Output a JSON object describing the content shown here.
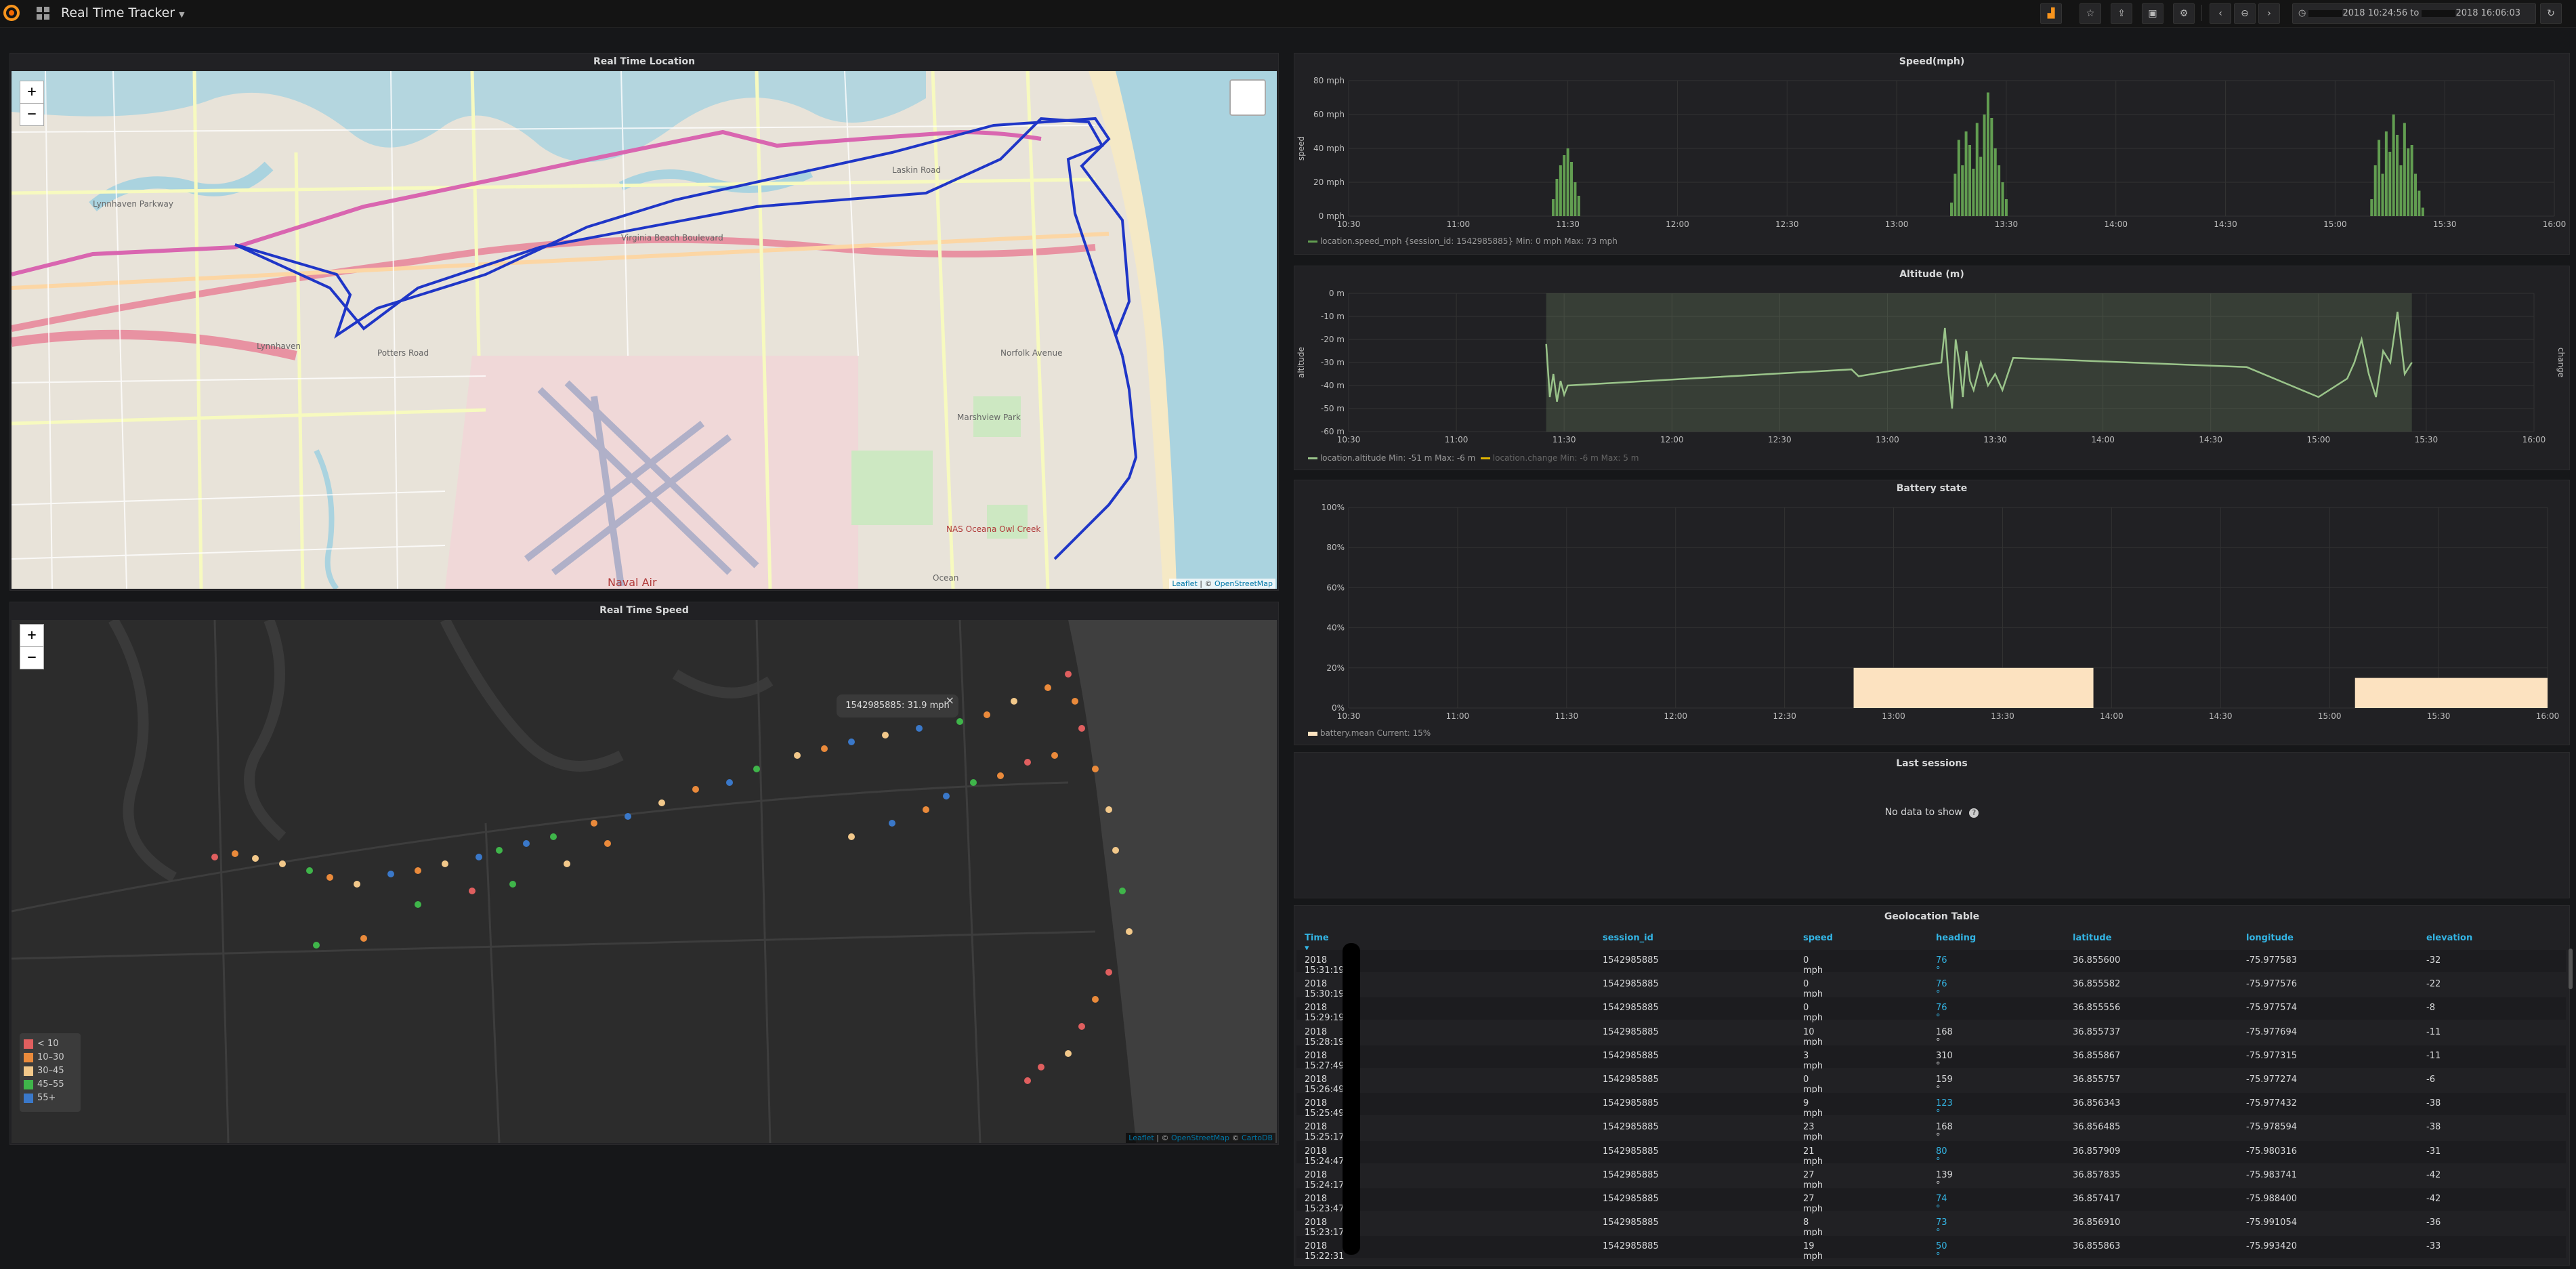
{
  "navbar": {
    "title": "Real Time Tracker",
    "time_range_from": "2018 10:24:56",
    "time_range_to_word": "to",
    "time_range_to": "2018 16:06:03",
    "icons": [
      "add-panel-icon",
      "star-icon",
      "share-icon",
      "save-icon",
      "gear-icon",
      "chevron-left-icon",
      "zoom-out-icon",
      "chevron-right-icon",
      "clock-icon",
      "refresh-icon"
    ]
  },
  "map1": {
    "title": "Real Time Location",
    "zoom_in": "+",
    "zoom_out": "−",
    "attrib_leaflet": "Leaflet",
    "attrib_osm": "OpenStreetMap",
    "place_labels": [
      "Lynnhaven",
      "Marshview Park",
      "NAS Oceana Owl Creek",
      "Naval Air",
      "Virginia Beach Boulevard",
      "Norfolk Avenue",
      "Potters Road",
      "Lynnhaven Parkway",
      "Laskin Road",
      "Ocean"
    ]
  },
  "map2": {
    "title": "Real Time Speed",
    "zoom_in": "+",
    "zoom_out": "−",
    "popup": "1542985885: 31.9 mph",
    "popup_close": "×",
    "attrib_leaflet": "Leaflet",
    "attrib_osm": "OpenStreetMap",
    "attrib_carto": "CartoDB",
    "legend": [
      {
        "label": "< 10",
        "color": "#e05f5f"
      },
      {
        "label": "10–30",
        "color": "#ea8a3b"
      },
      {
        "label": "30–45",
        "color": "#f2c88a"
      },
      {
        "label": "45–55",
        "color": "#3fb54a"
      },
      {
        "label": "55+",
        "color": "#3a78c9"
      }
    ]
  },
  "speed_panel": {
    "title": "Speed(mph)",
    "ylabel": "speed",
    "legend": "location.speed_mph {session_id: 1542985885}  Min: 0 mph  Max: 73 mph"
  },
  "altitude_panel": {
    "title": "Altitude (m)",
    "ylabel": "altitude",
    "ylabel_right": "change",
    "legend_1": "location.altitude  Min: -51 m  Max: -6 m",
    "legend_2": "location.change  Min: -6 m  Max: 5 m"
  },
  "battery_panel": {
    "title": "Battery state",
    "legend": "battery.mean  Current: 15%"
  },
  "sessions_panel": {
    "title": "Last sessions",
    "empty_text": "No data to show",
    "help_icon": "question-icon"
  },
  "table_panel": {
    "title": "Geolocation Table",
    "columns": [
      "Time",
      "session_id",
      "speed",
      "heading",
      "latitude",
      "longitude",
      "elevation"
    ],
    "rows": [
      [
        "2018 15:31:19",
        "1542985885",
        "0 mph",
        "76 °",
        "36.855600",
        "-75.977583",
        "-32"
      ],
      [
        "2018 15:30:19",
        "1542985885",
        "0 mph",
        "76 °",
        "36.855582",
        "-75.977576",
        "-22"
      ],
      [
        "2018 15:29:19",
        "1542985885",
        "0 mph",
        "76 °",
        "36.855556",
        "-75.977574",
        "-8"
      ],
      [
        "2018 15:28:19",
        "1542985885",
        "10 mph",
        "168 °",
        "36.855737",
        "-75.977694",
        "-11"
      ],
      [
        "2018 15:27:49",
        "1542985885",
        "3 mph",
        "310 °",
        "36.855867",
        "-75.977315",
        "-11"
      ],
      [
        "2018 15:26:49",
        "1542985885",
        "0 mph",
        "159 °",
        "36.855757",
        "-75.977274",
        "-6"
      ],
      [
        "2018 15:25:49",
        "1542985885",
        "9 mph",
        "123 °",
        "36.856343",
        "-75.977432",
        "-38"
      ],
      [
        "2018 15:25:17",
        "1542985885",
        "23 mph",
        "168 °",
        "36.856485",
        "-75.978594",
        "-38"
      ],
      [
        "2018 15:24:47",
        "1542985885",
        "21 mph",
        "80 °",
        "36.857909",
        "-75.980316",
        "-31"
      ],
      [
        "2018 15:24:17",
        "1542985885",
        "27 mph",
        "139 °",
        "36.857835",
        "-75.983741",
        "-42"
      ],
      [
        "2018 15:23:47",
        "1542985885",
        "27 mph",
        "74 °",
        "36.857417",
        "-75.988400",
        "-42"
      ],
      [
        "2018 15:23:17",
        "1542985885",
        "8 mph",
        "73 °",
        "36.856910",
        "-75.991054",
        "-36"
      ],
      [
        "2018 15:22:31",
        "1542985885",
        "19 mph",
        "50 °",
        "36.855863",
        "-75.993420",
        "-33"
      ]
    ],
    "blue_heading": [
      true,
      true,
      true,
      false,
      false,
      false,
      true,
      false,
      true,
      false,
      true,
      true,
      true
    ]
  },
  "chart_data": [
    {
      "type": "bar",
      "title": "Speed(mph)",
      "ylabel": "speed",
      "x_ticks": [
        "10:30",
        "11:00",
        "11:30",
        "12:00",
        "12:30",
        "13:00",
        "13:30",
        "14:00",
        "14:30",
        "15:00",
        "15:30",
        "16:00"
      ],
      "y_ticks": [
        "0 mph",
        "20 mph",
        "40 mph",
        "60 mph",
        "80 mph"
      ],
      "ylim": [
        0,
        80
      ],
      "series": [
        {
          "name": "location.speed_mph {session_id: 1542985885}",
          "color": "#629e51",
          "points": [
            [
              "11:26",
              10
            ],
            [
              "11:27",
              22
            ],
            [
              "11:28",
              30
            ],
            [
              "11:29",
              36
            ],
            [
              "11:30",
              40
            ],
            [
              "11:31",
              32
            ],
            [
              "11:32",
              20
            ],
            [
              "11:33",
              12
            ],
            [
              "13:15",
              8
            ],
            [
              "13:16",
              25
            ],
            [
              "13:17",
              45
            ],
            [
              "13:18",
              30
            ],
            [
              "13:19",
              50
            ],
            [
              "13:20",
              42
            ],
            [
              "13:21",
              28
            ],
            [
              "13:22",
              55
            ],
            [
              "13:23",
              35
            ],
            [
              "13:24",
              60
            ],
            [
              "13:25",
              73
            ],
            [
              "13:26",
              58
            ],
            [
              "13:27",
              40
            ],
            [
              "13:28",
              30
            ],
            [
              "13:29",
              20
            ],
            [
              "13:30",
              10
            ],
            [
              "15:10",
              10
            ],
            [
              "15:11",
              30
            ],
            [
              "15:12",
              45
            ],
            [
              "15:13",
              25
            ],
            [
              "15:14",
              50
            ],
            [
              "15:15",
              38
            ],
            [
              "15:16",
              60
            ],
            [
              "15:17",
              48
            ],
            [
              "15:18",
              30
            ],
            [
              "15:19",
              55
            ],
            [
              "15:20",
              40
            ],
            [
              "15:21",
              42
            ],
            [
              "15:22",
              25
            ],
            [
              "15:23",
              15
            ],
            [
              "15:24",
              5
            ]
          ]
        }
      ]
    },
    {
      "type": "line",
      "title": "Altitude (m)",
      "ylabel": "altitude",
      "x_ticks": [
        "10:30",
        "11:00",
        "11:30",
        "12:00",
        "12:30",
        "13:00",
        "13:30",
        "14:00",
        "14:30",
        "15:00",
        "15:30",
        "16:00"
      ],
      "y_ticks": [
        "0 m",
        "-10 m",
        "-20 m",
        "-30 m",
        "-40 m",
        "-50 m",
        "-60 m"
      ],
      "ylim": [
        -60,
        0
      ],
      "series": [
        {
          "name": "location.altitude",
          "color": "#9ac48a",
          "points": [
            [
              "11:25",
              -22
            ],
            [
              "11:26",
              -45
            ],
            [
              "11:27",
              -35
            ],
            [
              "11:28",
              -47
            ],
            [
              "11:29",
              -38
            ],
            [
              "11:30",
              -44
            ],
            [
              "11:31",
              -40
            ],
            [
              "12:50",
              -33
            ],
            [
              "12:52",
              -36
            ],
            [
              "13:15",
              -30
            ],
            [
              "13:16",
              -15
            ],
            [
              "13:17",
              -35
            ],
            [
              "13:18",
              -50
            ],
            [
              "13:19",
              -20
            ],
            [
              "13:20",
              -30
            ],
            [
              "13:21",
              -45
            ],
            [
              "13:22",
              -25
            ],
            [
              "13:23",
              -38
            ],
            [
              "13:24",
              -42
            ],
            [
              "13:26",
              -30
            ],
            [
              "13:28",
              -40
            ],
            [
              "13:30",
              -35
            ],
            [
              "13:32",
              -42
            ],
            [
              "13:35",
              -28
            ],
            [
              "14:40",
              -32
            ],
            [
              "15:00",
              -45
            ],
            [
              "15:08",
              -37
            ],
            [
              "15:10",
              -30
            ],
            [
              "15:12",
              -20
            ],
            [
              "15:14",
              -35
            ],
            [
              "15:16",
              -45
            ],
            [
              "15:18",
              -25
            ],
            [
              "15:20",
              -30
            ],
            [
              "15:22",
              -8
            ],
            [
              "15:24",
              -35
            ],
            [
              "15:26",
              -30
            ]
          ]
        }
      ]
    },
    {
      "type": "area",
      "title": "Battery state",
      "x_ticks": [
        "10:30",
        "11:00",
        "11:30",
        "12:00",
        "12:30",
        "13:00",
        "13:30",
        "14:00",
        "14:30",
        "15:00",
        "15:30",
        "16:00"
      ],
      "y_ticks": [
        "0%",
        "20%",
        "40%",
        "60%",
        "80%",
        "100%"
      ],
      "ylim": [
        0,
        100
      ],
      "series": [
        {
          "name": "battery.mean",
          "color": "#fce2c0",
          "points": [
            [
              "12:49",
              20
            ],
            [
              "13:55",
              20
            ],
            [
              "15:07",
              15
            ],
            [
              "16:00",
              15
            ]
          ]
        }
      ]
    }
  ]
}
